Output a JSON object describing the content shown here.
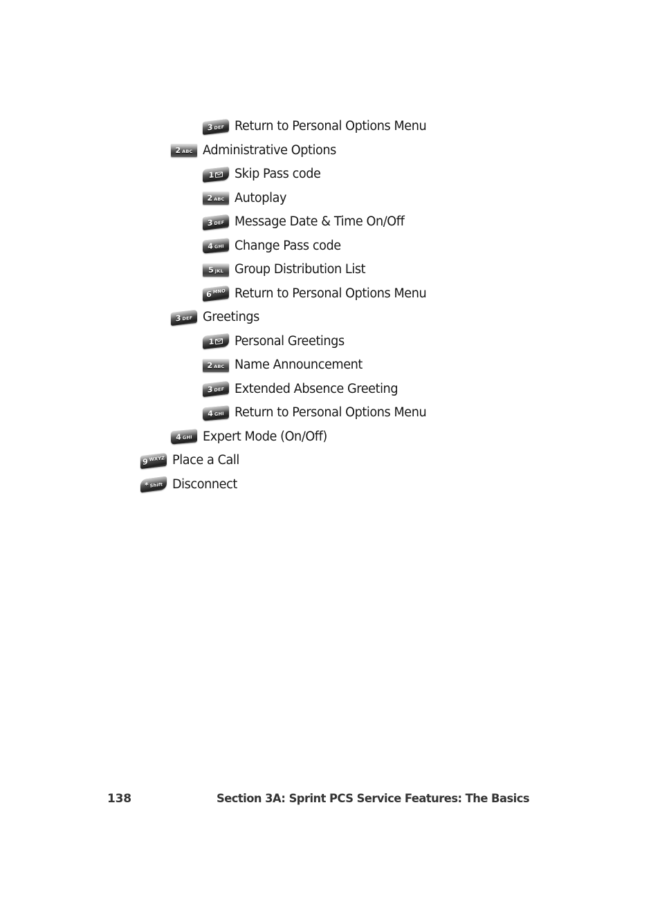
{
  "page": {
    "background": "#ffffff",
    "text_color": "#161616"
  },
  "menu": {
    "items": [
      {
        "key_number": "3",
        "key_letters": "DEF",
        "key_style": "skew",
        "indent": 1,
        "label": "Return to Personal Options Menu"
      },
      {
        "key_number": "2",
        "key_letters": "ABC",
        "key_style": "flat",
        "indent": 0,
        "label": "Administrative Options"
      },
      {
        "key_number": "1",
        "key_letters": "",
        "key_style": "curve",
        "indent": 1,
        "label": "Skip Pass code",
        "glyph": "envelope-icon"
      },
      {
        "key_number": "2",
        "key_letters": "ABC",
        "key_style": "flat",
        "indent": 1,
        "label": "Autoplay"
      },
      {
        "key_number": "3",
        "key_letters": "DEF",
        "key_style": "skew",
        "indent": 1,
        "label": "Message Date & Time On/Off"
      },
      {
        "key_number": "4",
        "key_letters": "GHI",
        "key_style": "skew2",
        "indent": 1,
        "label": "Change Pass code"
      },
      {
        "key_number": "5",
        "key_letters": "JKL",
        "key_style": "flat",
        "indent": 1,
        "label": "Group Distribution List"
      },
      {
        "key_number": "6",
        "key_letters": "MNO",
        "key_style": "skew",
        "indent": 1,
        "label": "Return to Personal Options Menu",
        "raised": true
      },
      {
        "key_number": "3",
        "key_letters": "DEF",
        "key_style": "skew",
        "indent": 0,
        "label": "Greetings"
      },
      {
        "key_number": "1",
        "key_letters": "",
        "key_style": "curve",
        "indent": 1,
        "label": "Personal Greetings",
        "glyph": "envelope-icon"
      },
      {
        "key_number": "2",
        "key_letters": "ABC",
        "key_style": "flat",
        "indent": 1,
        "label": "Name Announcement"
      },
      {
        "key_number": "3",
        "key_letters": "DEF",
        "key_style": "skew",
        "indent": 1,
        "label": "Extended Absence Greeting"
      },
      {
        "key_number": "4",
        "key_letters": "GHI",
        "key_style": "skew2",
        "indent": 1,
        "label": "Return to Personal Options Menu"
      },
      {
        "key_number": "4",
        "key_letters": "GHI",
        "key_style": "skew2",
        "indent": 0,
        "label": "Expert Mode (On/Off)"
      },
      {
        "key_number": "9",
        "key_letters": "WXYZ",
        "key_style": "skew",
        "indent": -1,
        "label": "Place a Call",
        "raised": true
      },
      {
        "key_number": "*",
        "key_letters": "Shift",
        "key_style": "star",
        "indent": -1,
        "label": "Disconnect"
      }
    ]
  },
  "footer": {
    "page_number": "138",
    "running_head": "Section 3A: Sprint PCS Service Features: The Basics"
  }
}
